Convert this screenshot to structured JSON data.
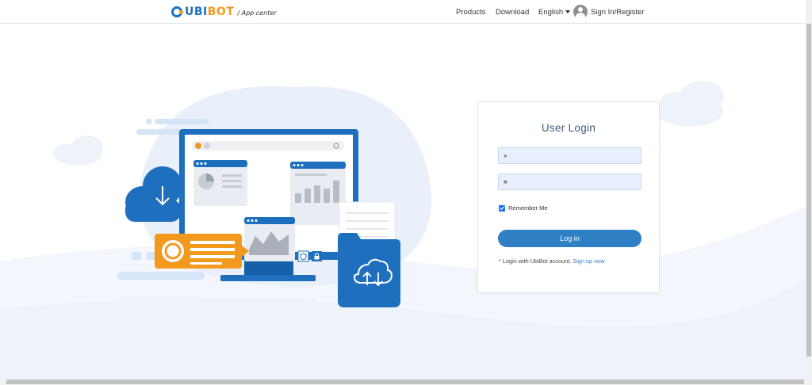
{
  "header": {
    "logo_text": "UBI",
    "logo_accent": "BOT",
    "logo_sub": "/ App center",
    "nav": {
      "products": "Products",
      "download": "Download",
      "language": "English",
      "signin": "Sign In/Register"
    }
  },
  "login": {
    "title": "User Login",
    "username_value": "",
    "password_value": "",
    "remember_label": "Remember Me",
    "remember_checked": true,
    "login_button": "Log in",
    "note_text": "* Login with UbiBot account.",
    "signup_link": "Sign up now"
  },
  "colors": {
    "brand_blue": "#1a73c7",
    "brand_orange": "#f39a1e",
    "button_blue": "#2f80c4",
    "field_bg": "#e8f0fe"
  },
  "icons": {
    "user": "user-icon",
    "lock": "lock-icon",
    "avatar": "avatar-icon",
    "cloud_upload": "cloud-upload-icon",
    "shield": "shield-icon",
    "lock_small": "lock-icon",
    "download_arrow": "download-arrow-icon"
  }
}
